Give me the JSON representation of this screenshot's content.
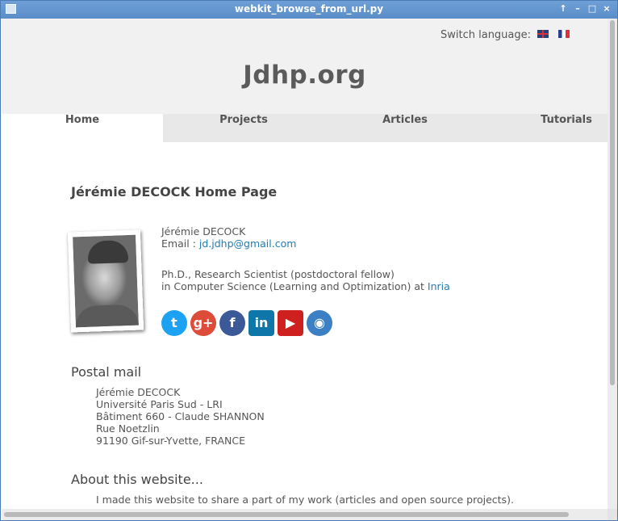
{
  "window": {
    "title": "webkit_browse_from_url.py",
    "controls": [
      "↑",
      "–",
      "□",
      "×"
    ]
  },
  "header": {
    "switch_language": "Switch language:",
    "flags": [
      "uk-flag-icon",
      "france-flag-icon"
    ],
    "logo": "Jdhp.org"
  },
  "nav": {
    "tabs": [
      "Home",
      "Projects",
      "Articles",
      "Tutorials"
    ],
    "active": "Home"
  },
  "main": {
    "title": "Jérémie DECOCK Home Page",
    "name": "Jérémie DECOCK",
    "email_label": "Email :",
    "email": "jd.jdhp@gmail.com",
    "role_line1": "Ph.D., Research Scientist (postdoctoral fellow)",
    "role_line2": "in Computer Science (Learning and Optimization) at",
    "affiliation_link": "Inria",
    "social": [
      {
        "name": "twitter-icon",
        "glyph": "t",
        "color": "#1da1f2"
      },
      {
        "name": "google-plus-icon",
        "glyph": "g+",
        "color": "#dd4b39"
      },
      {
        "name": "facebook-icon",
        "glyph": "f",
        "color": "#3b5998"
      },
      {
        "name": "linkedin-icon",
        "glyph": "in",
        "color": "#0e76a8"
      },
      {
        "name": "youtube-icon",
        "glyph": "▶",
        "color": "#cd201f"
      },
      {
        "name": "github-icon",
        "glyph": "◉",
        "color": "#3b7fc4"
      }
    ]
  },
  "postal": {
    "heading": "Postal mail",
    "lines": [
      "Jérémie DECOCK",
      "Université Paris Sud - LRI",
      "Bâtiment 660 - Claude SHANNON",
      "Rue Noetzlin",
      "91190 Gif-sur-Yvette, FRANCE"
    ]
  },
  "about": {
    "heading": "About this website...",
    "text": "I made this website to share a part of my work (articles and open source projects)."
  }
}
